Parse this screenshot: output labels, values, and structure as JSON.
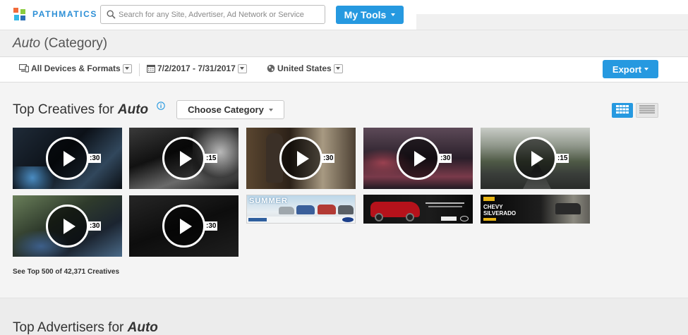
{
  "brand": {
    "name": "PATHMATICS",
    "accent": "#2699e0"
  },
  "search": {
    "placeholder": "Search for any Site, Advertiser, Ad Network or Service"
  },
  "nav": {
    "my_tools_label": "My Tools"
  },
  "page": {
    "title_prefix": "Auto",
    "title_suffix": " (Category)"
  },
  "filters": {
    "devices_label": "All Devices & Formats",
    "date_range": "7/2/2017 - 7/31/2017",
    "country": "United States",
    "export_label": "Export"
  },
  "creatives": {
    "heading_prefix": "Top Creatives for ",
    "heading_category": "Auto",
    "choose_category_label": "Choose Category",
    "see_more": "See Top 500 of 42,371 Creatives",
    "videos": [
      {
        "duration": ":30",
        "icon": "play-icon"
      },
      {
        "duration": ":15",
        "icon": "play-icon"
      },
      {
        "duration": ":30",
        "icon": "play-icon"
      },
      {
        "duration": ":30",
        "icon": "play-icon"
      },
      {
        "duration": ":15",
        "icon": "play-icon"
      },
      {
        "duration": ":30",
        "icon": "play-icon"
      },
      {
        "duration": ":30",
        "icon": "play-icon"
      }
    ],
    "banners": [
      {
        "headline": "SUMMER"
      },
      {
        "headline": ""
      },
      {
        "headline": "CHEVY SILVERADO"
      }
    ]
  },
  "advertisers": {
    "heading_prefix": "Top Advertisers for ",
    "heading_category": "Auto"
  }
}
